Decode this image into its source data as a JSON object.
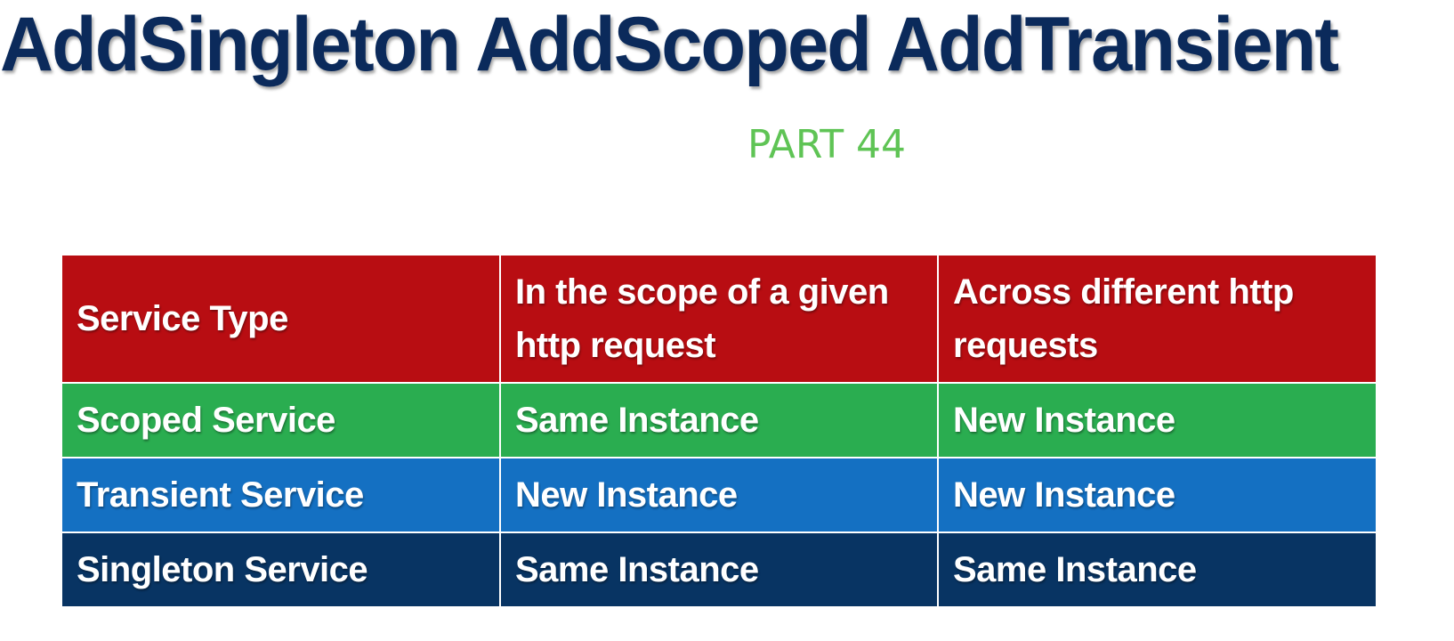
{
  "title": "AddSingleton AddScoped AddTransient",
  "subtitle": "PART 44",
  "colors": {
    "title": "#0b2a5b",
    "subtitle": "#5fc455",
    "header_bg": "#b80d12",
    "scoped_bg": "#2aad50",
    "transient_bg": "#1470c2",
    "singleton_bg": "#083463"
  },
  "table": {
    "headers": [
      "Service Type",
      "In the scope of a given http request",
      "Across different http requests"
    ],
    "rows": [
      [
        "Scoped Service",
        "Same Instance",
        "New Instance"
      ],
      [
        "Transient Service",
        "New Instance",
        "New Instance"
      ],
      [
        "Singleton Service",
        "Same Instance",
        "Same Instance"
      ]
    ]
  }
}
